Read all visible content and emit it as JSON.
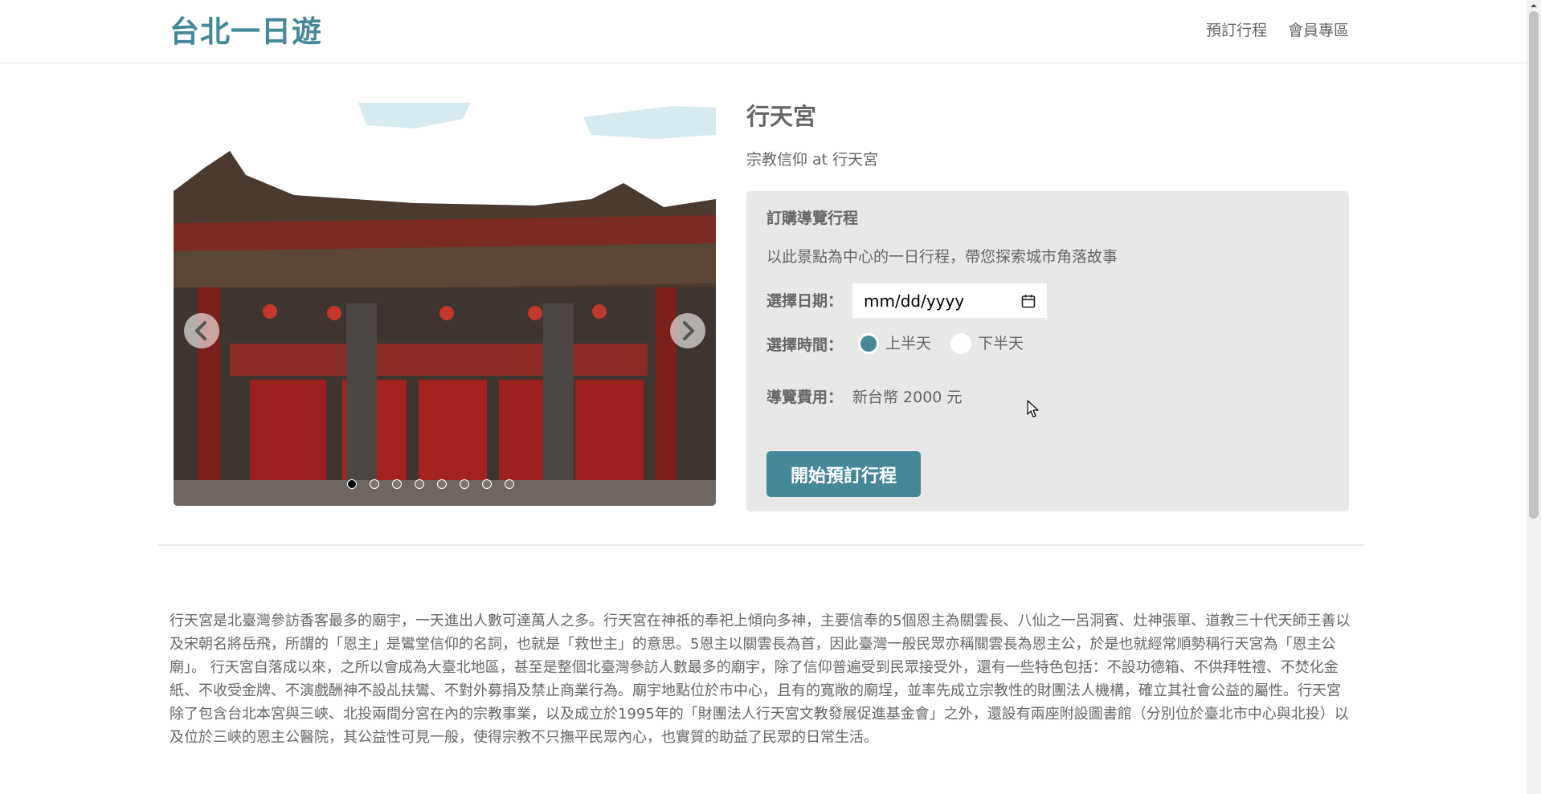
{
  "header": {
    "brand": "台北一日遊",
    "nav": [
      "預訂行程",
      "會員專區"
    ]
  },
  "attraction": {
    "name": "行天宮",
    "category_line": "宗教信仰 at 行天宮",
    "image_alt": "行天宮",
    "carousel": {
      "slide_count": 8,
      "active_index": 0
    }
  },
  "booking": {
    "title": "訂購導覽行程",
    "description": "以此景點為中心的一日行程，帶您探索城市角落故事",
    "date_label": "選擇日期：",
    "date_placeholder": "mm/dd/yyyy",
    "time_label": "選擇時間：",
    "time_options": [
      "上半天",
      "下半天"
    ],
    "time_selected": "上半天",
    "fee_label": "導覽費用：",
    "fee_value": "新台幣 2000 元",
    "submit_label": "開始預訂行程"
  },
  "description": "行天宮是北臺灣參訪香客最多的廟宇，一天進出人數可達萬人之多。行天宮在神祇的奉祀上傾向多神，主要信奉的5個恩主為關雲長、八仙之一呂洞賓、灶神張單、道教三十代天師王善以及宋朝名將岳飛，所謂的「恩主」是鸞堂信仰的名詞，也就是「救世主」的意思。5恩主以關雲長為首，因此臺灣一般民眾亦稱關雲長為恩主公，於是也就經常順勢稱行天宮為「恩主公廟」。 行天宮自落成以來，之所以會成為大臺北地區，甚至是整個北臺灣參訪人數最多的廟宇，除了信仰普遍受到民眾接受外，還有一些特色包括：不設功德箱、不供拜牲禮、不焚化金紙、不收受金牌、不演戲酬神不設乩扶鸞、不對外募捐及禁止商業行為。廟宇地點位於市中心，且有的寬敞的廟埕，並率先成立宗教性的財團法人機構，確立其社會公益的屬性。行天宮除了包含台北本宮與三峽、北投兩間分宮在內的宗教事業，以及成立於1995年的「財團法人行天宮文教發展促進基金會」之外，還設有兩座附設圖書館（分別位於臺北市中心與北投）以及位於三峽的恩主公醫院，其公益性可見一般，使得宗教不只撫平民眾內心，也實質的助益了民眾的日常生活。",
  "colors": {
    "brand": "#448899",
    "text": "#666666",
    "panel_bg": "#e8e8e8",
    "button_bg": "#448899"
  },
  "icons": [
    "calendar-icon",
    "chevron-left-icon",
    "chevron-right-icon",
    "cursor-arrow-icon"
  ]
}
